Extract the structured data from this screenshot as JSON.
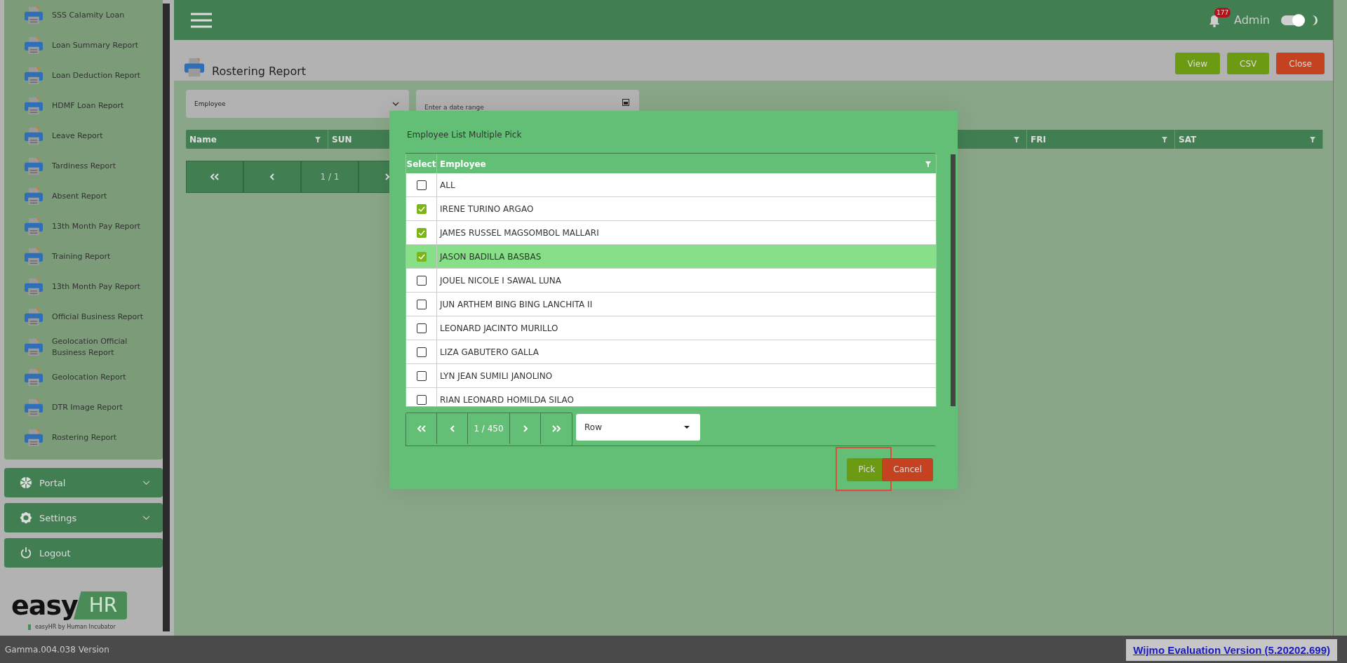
{
  "sidebar": {
    "items": [
      {
        "label": "SSS Calamity Loan"
      },
      {
        "label": "Loan Summary Report"
      },
      {
        "label": "Loan Deduction Report"
      },
      {
        "label": "HDMF Loan Report"
      },
      {
        "label": "Leave Report"
      },
      {
        "label": "Tardiness Report"
      },
      {
        "label": "Absent Report"
      },
      {
        "label": "13th Month Pay Report"
      },
      {
        "label": "Training Report"
      },
      {
        "label": "13th Month Pay Report"
      },
      {
        "label": "Official Business Report"
      },
      {
        "label": "Geolocation Official Business Report"
      },
      {
        "label": "Geolocation Report"
      },
      {
        "label": "DTR Image Report"
      },
      {
        "label": "Rostering Report"
      }
    ],
    "sections": [
      {
        "label": "Portal",
        "kind": "portal",
        "expanded": false
      },
      {
        "label": "Settings",
        "kind": "settings",
        "expanded": false
      },
      {
        "label": "Logout",
        "kind": "logout"
      }
    ],
    "logo": {
      "word": "easy",
      "badge": "HR",
      "tagline": "easyHR by Human Incubator"
    }
  },
  "header": {
    "notifications": "177",
    "user": "Admin",
    "theme_toggle": {
      "on": true
    }
  },
  "page": {
    "title": "Rostering Report",
    "buttons": [
      {
        "label": "View",
        "kind": "primary"
      },
      {
        "label": "CSV",
        "kind": "primary"
      },
      {
        "label": "Close",
        "kind": "danger"
      }
    ],
    "employee_select": {
      "value": "Employee"
    },
    "date_range": {
      "placeholder": "Enter a date range"
    },
    "grid": {
      "columns": [
        "Name",
        "SUN",
        "FRI",
        "SAT"
      ]
    },
    "pager": {
      "page": "1 / 1"
    }
  },
  "dialog": {
    "title": "Employee List Multiple Pick",
    "columns": [
      "Select",
      "Employee"
    ],
    "rows": [
      {
        "name": "ALL",
        "checked": false,
        "selected": false
      },
      {
        "name": "IRENE TURINO ARGAO",
        "checked": true,
        "selected": false
      },
      {
        "name": "JAMES RUSSEL MAGSOMBOL MALLARI",
        "checked": true,
        "selected": false
      },
      {
        "name": "JASON BADILLA BASBAS",
        "checked": true,
        "selected": true
      },
      {
        "name": "JOUEL NICOLE I SAWAL LUNA",
        "checked": false,
        "selected": false
      },
      {
        "name": "JUN ARTHEM BING BING LANCHITA II",
        "checked": false,
        "selected": false
      },
      {
        "name": "LEONARD JACINTO MURILLO",
        "checked": false,
        "selected": false
      },
      {
        "name": "LIZA GABUTERO GALLA",
        "checked": false,
        "selected": false
      },
      {
        "name": "LYN JEAN SUMILI JANOLINO",
        "checked": false,
        "selected": false
      },
      {
        "name": "RIAN LEONARD HOMILDA SILAO",
        "checked": false,
        "selected": false
      }
    ],
    "pager": {
      "page": "1 / 450"
    },
    "mode_select": {
      "value": "Row"
    },
    "buttons": [
      {
        "label": "Pick",
        "kind": "primary",
        "highlighted": true
      },
      {
        "label": "Cancel",
        "kind": "danger",
        "highlighted": false
      }
    ]
  },
  "status_bar": {
    "version": "Gamma.004.038 Version",
    "license": "Wijmo Evaluation Version (5.20202.699)"
  }
}
